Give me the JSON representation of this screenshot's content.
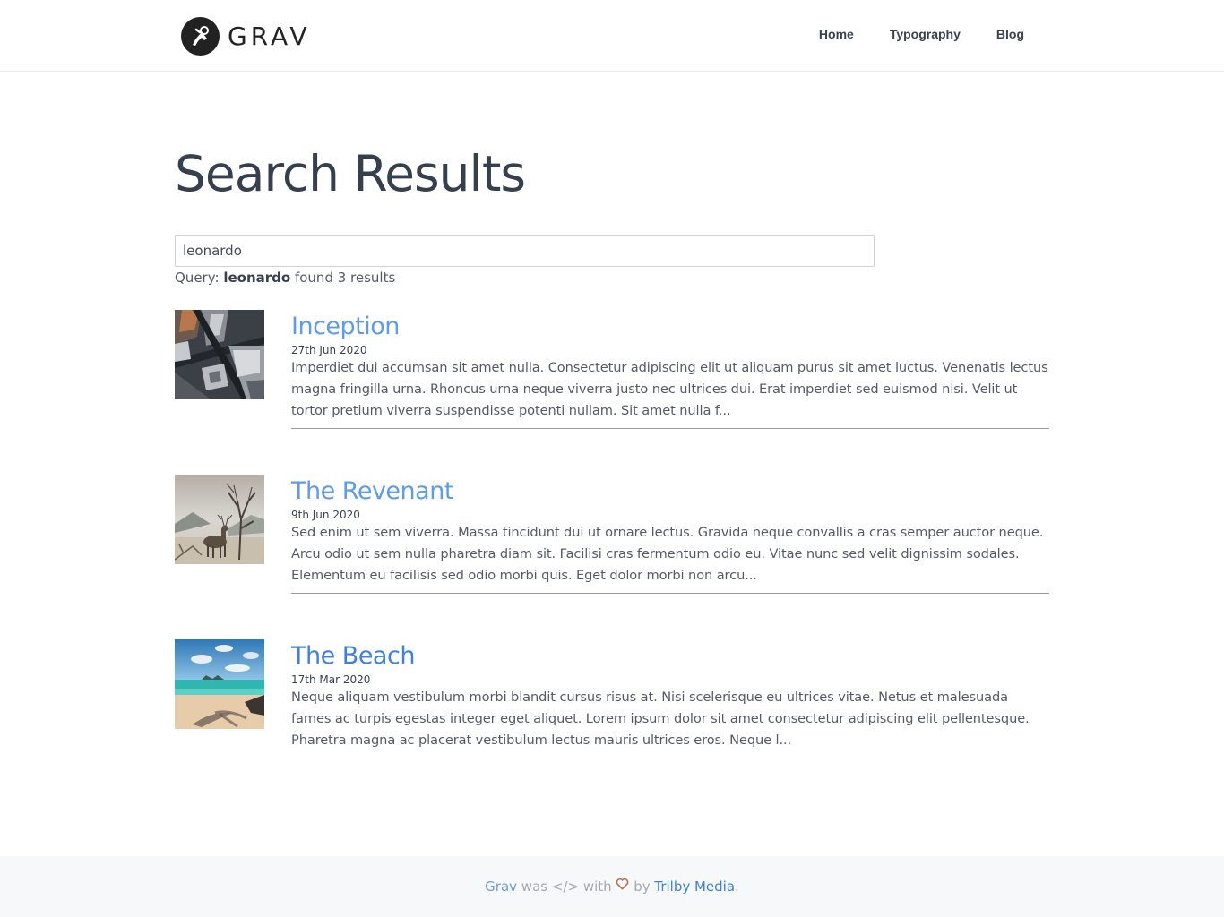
{
  "header": {
    "logo_text": "GRAV",
    "nav": [
      {
        "label": "Home"
      },
      {
        "label": "Typography"
      },
      {
        "label": "Blog"
      }
    ]
  },
  "main": {
    "title": "Search Results",
    "search": {
      "value": "leonardo",
      "placeholder": ""
    },
    "query": {
      "prefix": "Query: ",
      "term": "leonardo",
      "suffix": " found 3 results"
    },
    "results": [
      {
        "title": "Inception",
        "date": "27th Jun 2020",
        "excerpt": "Imperdiet dui accumsan sit amet nulla. Consectetur adipiscing elit ut aliquam purus sit amet luctus. Venenatis lectus magna fringilla urna. Rhoncus urna neque viverra justo nec ultrices dui. Erat imperdiet sed euismod nisi. Velit ut tortor pretium viverra suspendisse potenti nullam. Sit amet nulla f...",
        "thumbnail": "aerial-city-image"
      },
      {
        "title": "The Revenant",
        "date": "9th Jun 2020",
        "excerpt": "Sed enim ut sem viverra. Massa tincidunt dui ut ornare lectus. Gravida neque convallis a cras semper auctor neque. Arcu odio ut sem nulla pharetra diam sit. Facilisi cras fermentum odio eu. Vitae nunc sed velit dignissim sodales. Elementum eu facilisis sed odio morbi quis. Eget dolor morbi non arcu...",
        "thumbnail": "deer-tree-image"
      },
      {
        "title": "The Beach",
        "date": "17th Mar 2020",
        "excerpt": "Neque aliquam vestibulum morbi blandit cursus risus at. Nisi scelerisque eu ultrices vitae. Netus et malesuada fames ac turpis egestas integer eget aliquet. Lorem ipsum dolor sit amet consectetur adipiscing elit pellentesque. Pharetra magna ac placerat vestibulum lectus mauris ultrices eros. Neque l...",
        "thumbnail": "beach-image"
      }
    ]
  },
  "footer": {
    "grav_link": "Grav",
    "was": " was ",
    "code_glyph": "</>",
    "with": " with ",
    "by": " by ",
    "trilby_link": "Trilby Media",
    "period": "."
  },
  "colors": {
    "link": "#5e9be8",
    "link_active": "#3d7fe3",
    "text": "#3a4150",
    "footer_bg": "#f7f8f9",
    "heart": "#c0714f"
  }
}
